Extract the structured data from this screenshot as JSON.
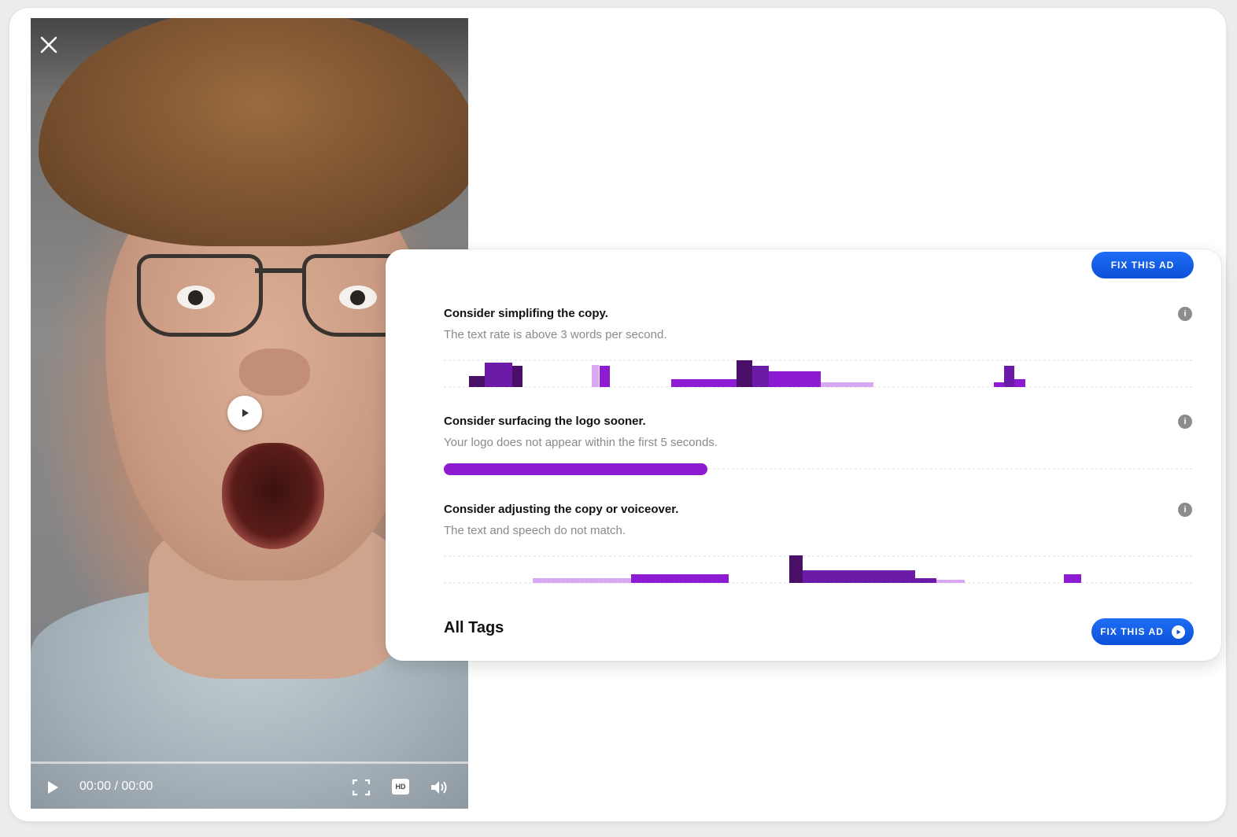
{
  "player": {
    "time": "00:00 / 00:00",
    "progress": 0,
    "hd_label": "HD"
  },
  "colors": {
    "accent_blue": "#1e6ef5",
    "dark_purple": "#4a0f66",
    "purple": "#6c1aa8",
    "bright_purple": "#8d1bd1",
    "light_purple": "#d8a8f2"
  },
  "panel": {
    "fix_top_label": "FIX THIS AD",
    "fix_bottom_label": "FIX THIS AD",
    "all_tags": "All Tags",
    "sections": [
      {
        "title": "Consider simplifing the copy.",
        "description": "The text rate is above 3 words per second.",
        "info_icon": "i"
      },
      {
        "title": "Consider surfacing the logo sooner.",
        "description": "Your logo does not appear within the first 5 seconds.",
        "info_icon": "i"
      },
      {
        "title": "Consider adjusting the copy or voiceover.",
        "description": "The text and speech do not match.",
        "info_icon": "i"
      }
    ]
  }
}
